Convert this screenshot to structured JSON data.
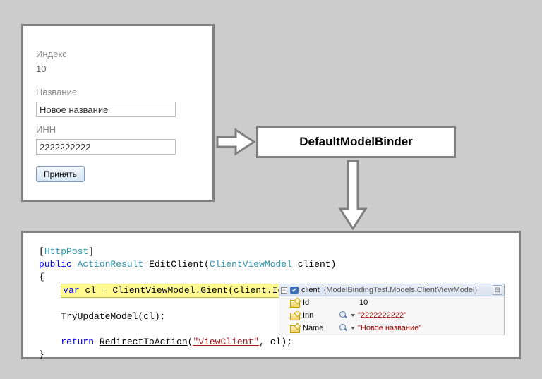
{
  "form": {
    "index_label": "Индекс",
    "index_value": "10",
    "name_label": "Название",
    "name_value": "Новое название",
    "inn_label": "ИНН",
    "inn_value": "2222222222",
    "submit_label": "Принять"
  },
  "binder": {
    "title": "DefaultModelBinder"
  },
  "code": {
    "attr": "HttpPost",
    "public": "public",
    "return_type": "ActionResult",
    "method": "EditClient",
    "param_type": "ClientViewModel",
    "param_name": "client",
    "hl_var": "var",
    "hl_rest": " cl = ClientViewModel.Gient(client.Id);",
    "try_line": "TryUpdateModel(cl);",
    "return_kw": "return",
    "redirect": "RedirectToAction",
    "view_str": "\"ViewClient\"",
    "tail": ", cl);"
  },
  "debug": {
    "var_name": "client",
    "var_type": "{ModelBindingTest.Models.ClientViewModel}",
    "rows": {
      "id_name": "Id",
      "id_val": "10",
      "inn_name": "Inn",
      "inn_val": "\"2222222222\"",
      "name_name": "Name",
      "name_val": "\"Новое название\""
    }
  }
}
